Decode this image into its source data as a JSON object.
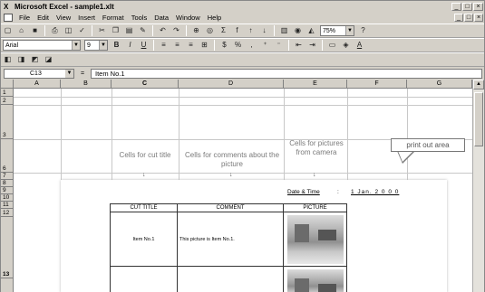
{
  "window": {
    "title": "Microsoft Excel - sample1.xlt",
    "app_icon": "X",
    "minimize": "_",
    "maximize": "□",
    "close": "×"
  },
  "menu": {
    "items": [
      "File",
      "Edit",
      "View",
      "Insert",
      "Format",
      "Tools",
      "Data",
      "Window",
      "Help"
    ]
  },
  "toolbar": {
    "zoom": "75%",
    "font": "Arial",
    "size": "9",
    "bold": "B",
    "italic": "I",
    "underline": "U",
    "sigma": "Σ",
    "fx": "f",
    "currency": "$",
    "percent": "%",
    "comma": ","
  },
  "formula_bar": {
    "cell_ref": "C13",
    "eq": "=",
    "content": "Item No.1"
  },
  "columns": [
    "A",
    "B",
    "C",
    "D",
    "E",
    "F",
    "G"
  ],
  "rows": [
    "1",
    "2",
    "3",
    "6",
    "7",
    "8",
    "9",
    "10",
    "11",
    "12",
    "13"
  ],
  "annotations": {
    "cut_title": "Cells for cut title",
    "comments": "Cells for comments about the picture",
    "pictures": "Cells for pictures from camera",
    "print_area": "print out area"
  },
  "report": {
    "date_label": "Date & Time",
    "date_sep": ":",
    "date_value": "1 Jan. 2 0 0 0",
    "headers": [
      "CUT TITLE",
      "COMMENT",
      "PICTURE"
    ],
    "row1": {
      "title": "Item No.1",
      "comment": "This picture is Item No.1."
    }
  },
  "icons": {
    "scroll_up": "▲",
    "combo_arrow": "▼"
  }
}
